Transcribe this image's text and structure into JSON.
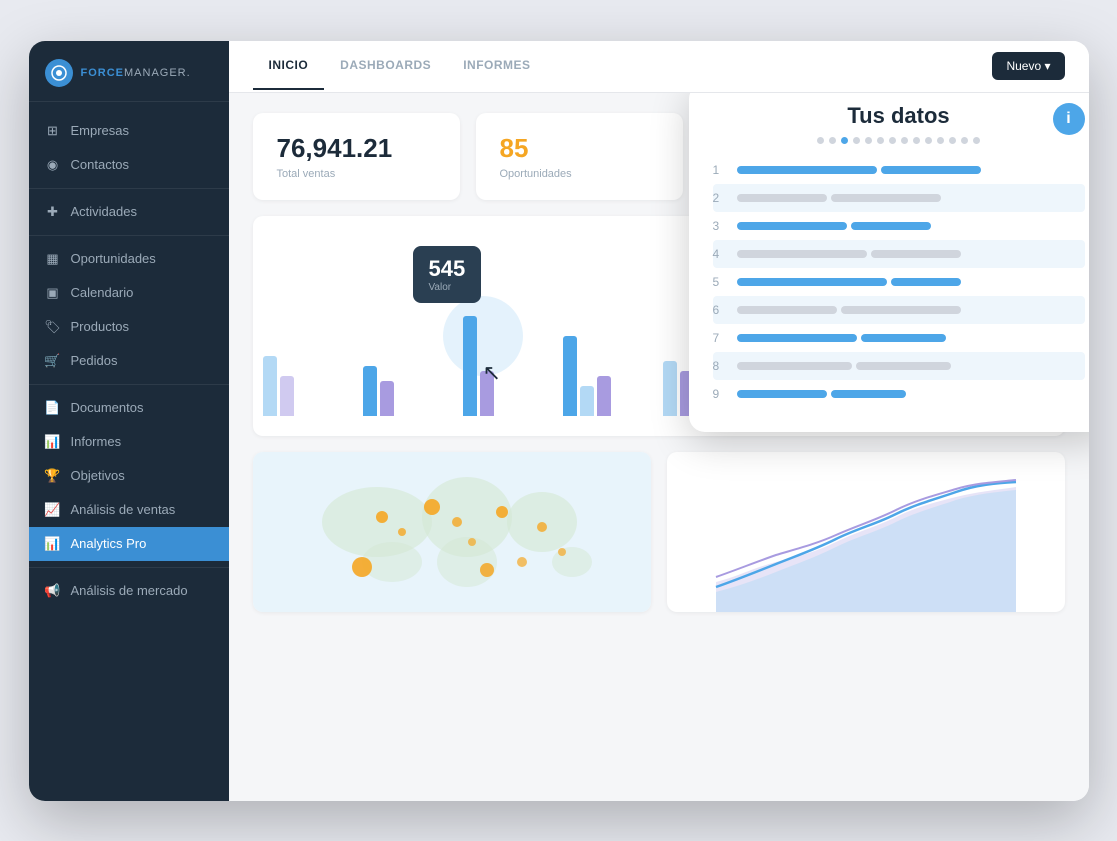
{
  "app": {
    "logo_text": "FORCE",
    "logo_text_brand": "MANAGER.",
    "logo_icon": "FM"
  },
  "sidebar": {
    "items": [
      {
        "id": "empresas",
        "label": "Empresas",
        "icon": "🏢",
        "active": false
      },
      {
        "id": "contactos",
        "label": "Contactos",
        "icon": "👤",
        "active": false
      },
      {
        "id": "actividades",
        "label": "Actividades",
        "icon": "+",
        "active": false,
        "divider_before": true
      },
      {
        "id": "oportunidades",
        "label": "Oportunidades",
        "icon": "📋",
        "active": false,
        "divider_before": true
      },
      {
        "id": "calendario",
        "label": "Calendario",
        "icon": "📅",
        "active": false
      },
      {
        "id": "productos",
        "label": "Productos",
        "icon": "🏷",
        "active": false
      },
      {
        "id": "pedidos",
        "label": "Pedidos",
        "icon": "🛒",
        "active": false
      },
      {
        "id": "documentos",
        "label": "Documentos",
        "icon": "📄",
        "active": false,
        "divider_before": true
      },
      {
        "id": "informes",
        "label": "Informes",
        "icon": "📊",
        "active": false
      },
      {
        "id": "objetivos",
        "label": "Objetivos",
        "icon": "🏆",
        "active": false
      },
      {
        "id": "analisis-ventas",
        "label": "Análisis de ventas",
        "icon": "📈",
        "active": false
      },
      {
        "id": "analytics-pro",
        "label": "Analytics Pro",
        "icon": "📊",
        "active": true
      },
      {
        "id": "analisis-mercado",
        "label": "Análisis de mercado",
        "icon": "📢",
        "active": false,
        "divider_before": true
      }
    ]
  },
  "tabs": [
    {
      "id": "inicio",
      "label": "INICIO",
      "active": true
    },
    {
      "id": "dashboards",
      "label": "DASHBOARDS",
      "active": false
    },
    {
      "id": "informes",
      "label": "INFORMES",
      "active": false
    }
  ],
  "toolbar": {
    "new_button": "Nuevo ▾"
  },
  "stats": [
    {
      "value": "76,941.21",
      "label": "Total ventas",
      "orange": false
    },
    {
      "value": "85",
      "label": "Oportunidades",
      "orange": true
    }
  ],
  "chart": {
    "tooltip_value": "545",
    "tooltip_label": "Valor"
  },
  "popup": {
    "title": "Tus datos",
    "info_button": "i",
    "dots": [
      false,
      false,
      true,
      false,
      false,
      false,
      false,
      false,
      false,
      false,
      false,
      false,
      false,
      false
    ],
    "rows": [
      {
        "num": 1,
        "bar1_width": 140,
        "bar2_width": 100,
        "highlighted": false
      },
      {
        "num": 2,
        "bar1_width": 90,
        "bar2_width": 120,
        "highlighted": true
      },
      {
        "num": 3,
        "bar1_width": 110,
        "bar2_width": 80,
        "highlighted": false
      },
      {
        "num": 4,
        "bar1_width": 130,
        "bar2_width": 0,
        "highlighted": true
      },
      {
        "num": 5,
        "bar1_width": 160,
        "bar2_width": 70,
        "highlighted": false
      },
      {
        "num": 6,
        "bar1_width": 0,
        "bar2_width": 140,
        "highlighted": true
      },
      {
        "num": 7,
        "bar1_width": 120,
        "bar2_width": 90,
        "highlighted": false
      },
      {
        "num": 8,
        "bar1_width": 0,
        "bar2_width": 130,
        "highlighted": true
      },
      {
        "num": 9,
        "bar1_width": 100,
        "bar2_width": 85,
        "highlighted": false
      }
    ]
  },
  "colors": {
    "sidebar_bg": "#1c2b3a",
    "accent_blue": "#4da6e8",
    "accent_orange": "#f5a623",
    "active_sidebar": "#3b8fd4"
  }
}
